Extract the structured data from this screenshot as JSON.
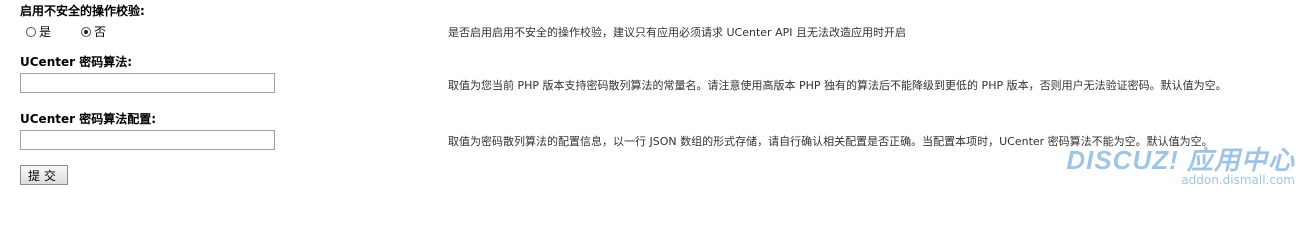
{
  "settings": [
    {
      "label": "启用不安全的操作校验:",
      "tip": "是否启用启用不安全的操作校验，建议只有应用必须请求 UCenter API 且无法改造应用时开启",
      "options": [
        {
          "label": "是",
          "checked": false
        },
        {
          "label": "否",
          "checked": true
        }
      ]
    },
    {
      "label": "UCenter 密码算法:",
      "tip": "取值为您当前 PHP 版本支持密码散列算法的常量名。请注意使用高版本 PHP 独有的算法后不能降级到更低的 PHP 版本，否则用户无法验证密码。默认值为空。",
      "value": ""
    },
    {
      "label": "UCenter 密码算法配置:",
      "tip": "取值为密码散列算法的配置信息，以一行 JSON 数组的形式存储，请自行确认相关配置是否正确。当配置本项时，UCenter 密码算法不能为空。默认值为空。",
      "value": ""
    }
  ],
  "submit_label": "提交",
  "watermark": {
    "logo_text": "DISCUZ! 应用中心",
    "url_text": "addon.dismall.com",
    "color": "#2d7fc7"
  }
}
